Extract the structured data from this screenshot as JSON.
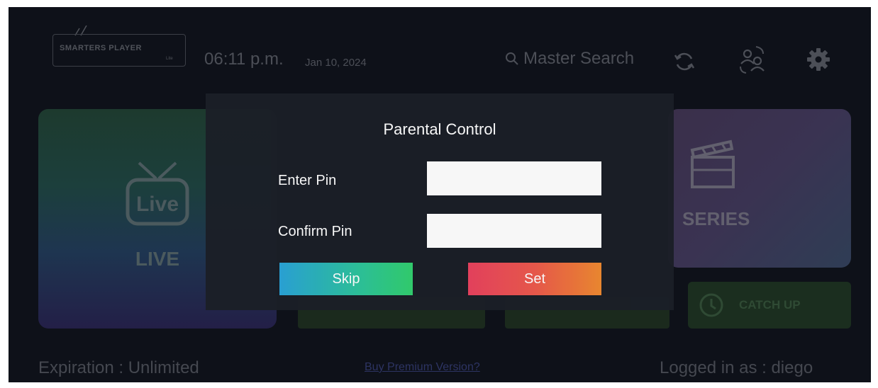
{
  "header": {
    "logo_text": "SMARTERS PLAYER",
    "logo_sub": "Lite",
    "time": "06:11 p.m.",
    "date": "Jan 10, 2024",
    "search_label": "Master Search"
  },
  "tiles": {
    "live_label": "LIVE",
    "live_icon_text": "Live",
    "series_label": "SERIES",
    "catchup_label": "CATCH UP"
  },
  "footer": {
    "expiration": "Expiration : Unlimited",
    "buy_link": "Buy Premium Version?",
    "logged_in": "Logged in as : diego"
  },
  "dialog": {
    "title": "Parental Control",
    "pin_label": "Enter Pin",
    "pin_value": "",
    "confirm_label": "Confirm Pin",
    "confirm_value": "",
    "skip_label": "Skip",
    "set_label": "Set"
  },
  "colors": {
    "skip_gradient": [
      "#2aa4d8",
      "#33cf6e"
    ],
    "set_gradient": [
      "#e9425f",
      "#f08a30"
    ],
    "dialog_bg": "#1b1f27"
  }
}
